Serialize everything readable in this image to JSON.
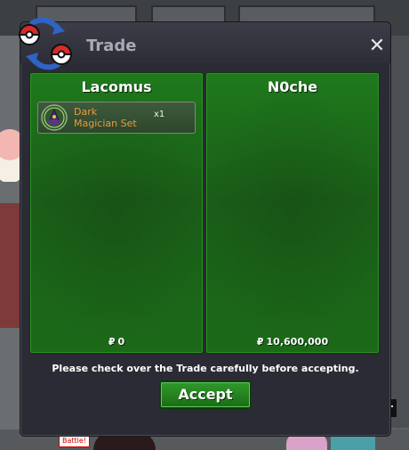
{
  "window": {
    "title": "Trade",
    "close_glyph": "✕",
    "notice": "Please check over the Trade carefully before accepting.",
    "accept_label": "Accept"
  },
  "left_panel": {
    "player_name": "Lacomus",
    "items": [
      {
        "name_line1": "Dark",
        "name_line2": "Magician Set",
        "quantity": "x1",
        "icon": "costume-icon"
      }
    ],
    "currency_symbol": "₽",
    "money": "0"
  },
  "right_panel": {
    "player_name": "N0che",
    "items": [],
    "currency_symbol": "₽",
    "money": "10,600,000"
  },
  "background": {
    "battle_tag": "Battle!",
    "edge_label": "r"
  },
  "colors": {
    "panel_green": "#1f7a1c",
    "item_name_orange": "#e89a3c",
    "window_bg": "#2a2b34"
  }
}
